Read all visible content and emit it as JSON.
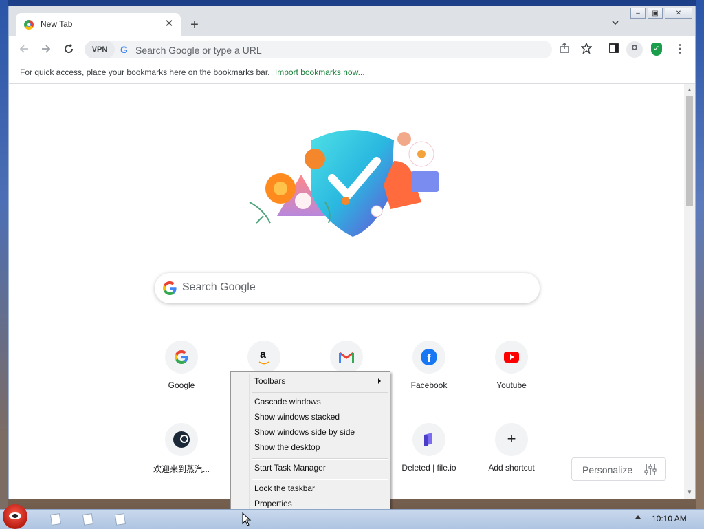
{
  "browser": {
    "tab_title": "New Tab",
    "tab_close": "✕",
    "new_tab": "+",
    "vpn_label": "VPN",
    "omnibox_placeholder": "Search Google or type a URL",
    "bookmarks_text": "For quick access, place your bookmarks here on the bookmarks bar.",
    "import_link": "Import bookmarks now..."
  },
  "ntp": {
    "search_placeholder": "Search Google",
    "shortcuts": [
      {
        "label": "Google",
        "icon": "google-icon"
      },
      {
        "label": "Amazon",
        "icon": "amazon-icon"
      },
      {
        "label": "Gmail",
        "icon": "gmail-icon"
      },
      {
        "label": "Facebook",
        "icon": "facebook-icon"
      },
      {
        "label": "Youtube",
        "icon": "youtube-icon"
      },
      {
        "label": "欢迎来到蒸汽...",
        "icon": "steam-icon"
      },
      {
        "label": "Deleted | file.io",
        "icon": "fileio-icon"
      },
      {
        "label": "Add shortcut",
        "icon": "plus-icon"
      }
    ],
    "personalize": "Personalize"
  },
  "context_menu": {
    "items": [
      "Toolbars",
      "Cascade windows",
      "Show windows stacked",
      "Show windows side by side",
      "Show the desktop",
      "Start Task Manager",
      "Lock the taskbar",
      "Properties"
    ]
  },
  "taskbar": {
    "clock": "10:10 AM"
  },
  "colors": {
    "accent_green": "#188038",
    "shield_green": "#1a9e4c",
    "youtube_red": "#ff0000",
    "facebook_blue": "#1877f2"
  }
}
